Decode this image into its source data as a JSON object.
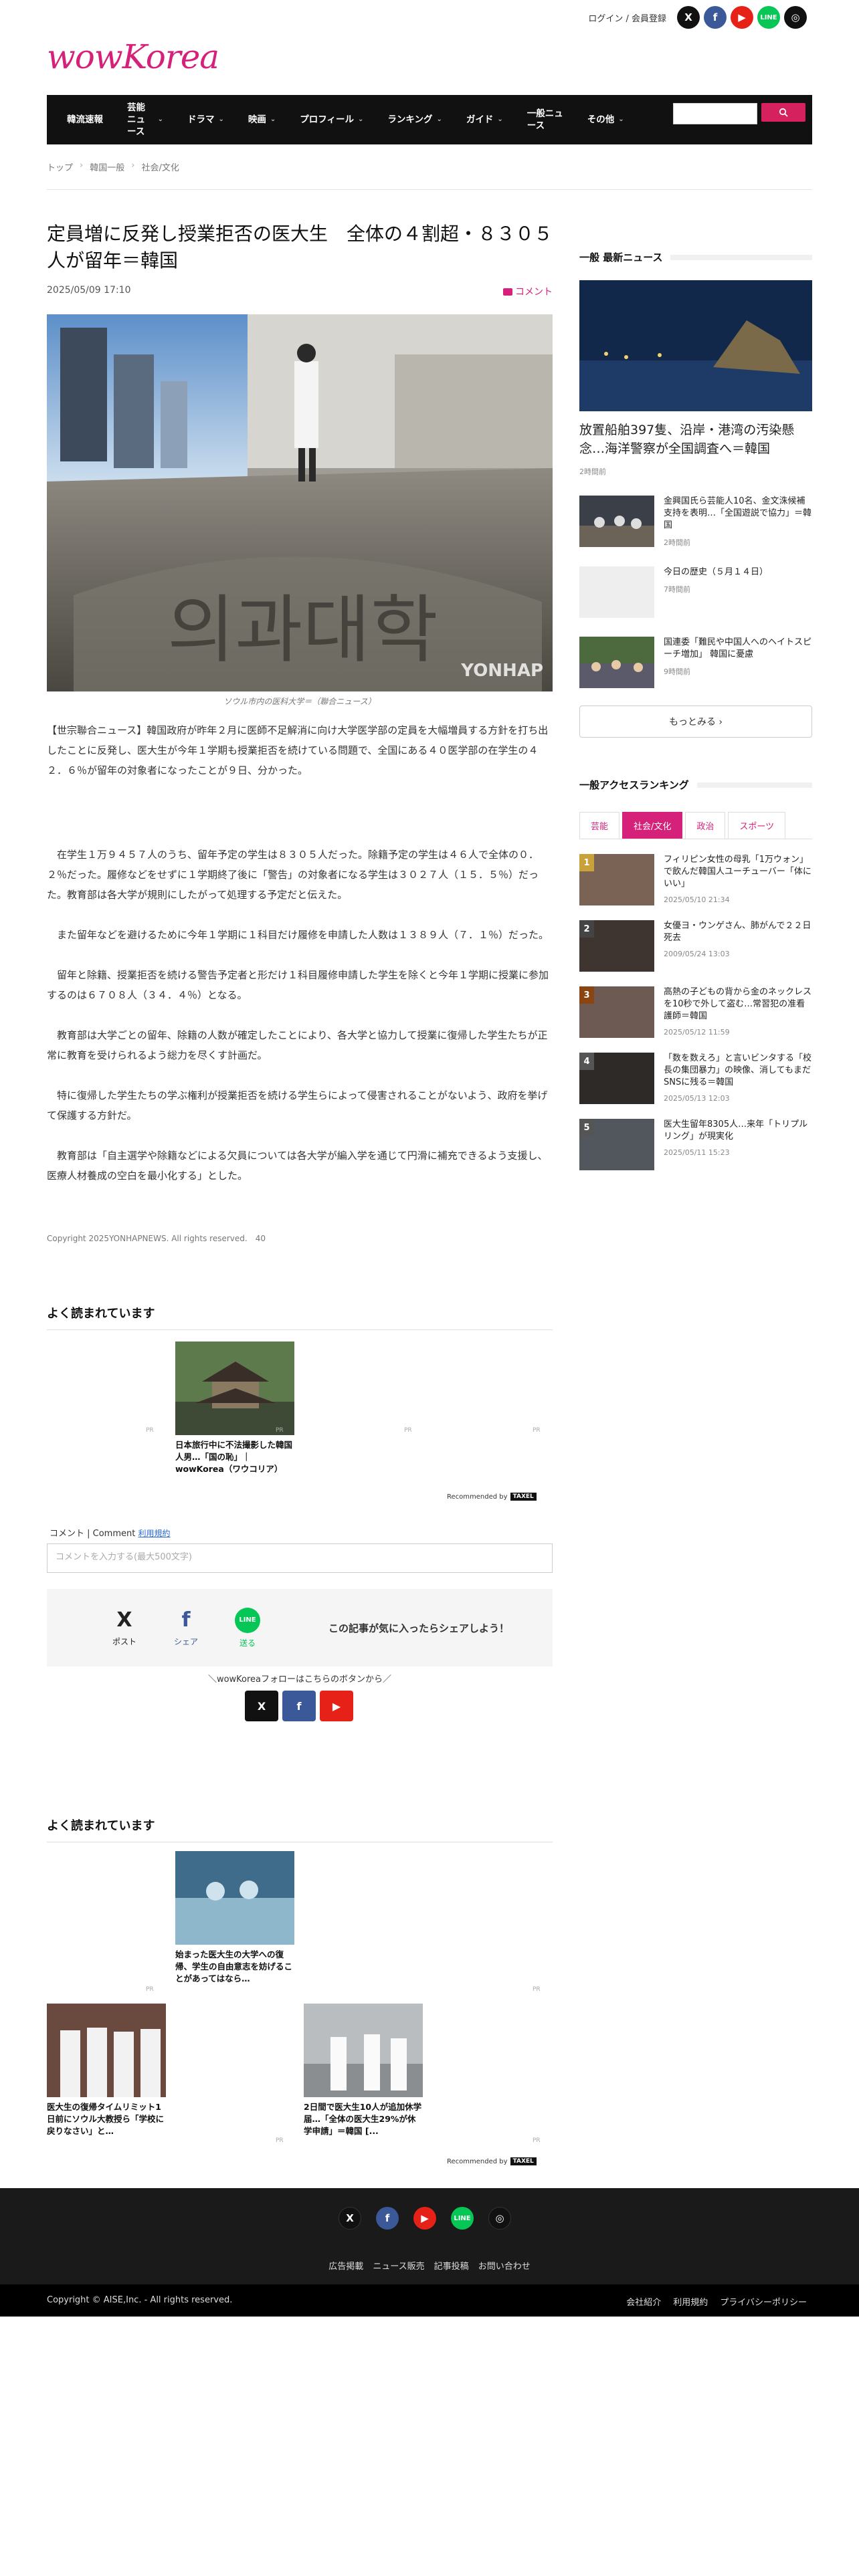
{
  "header": {
    "login": "ログイン / 会員登録",
    "logo": "wowKorea",
    "social": [
      "X",
      "f",
      "▶",
      "LINE",
      "◎"
    ]
  },
  "nav": {
    "items": [
      {
        "label": "韓流速報",
        "dropdown": false
      },
      {
        "label": "芸能ニュース",
        "dropdown": true
      },
      {
        "label": "ドラマ",
        "dropdown": true
      },
      {
        "label": "映画",
        "dropdown": true
      },
      {
        "label": "プロフィール",
        "dropdown": true
      },
      {
        "label": "ランキング",
        "dropdown": true
      },
      {
        "label": "ガイド",
        "dropdown": true
      },
      {
        "label": "一般ニュース",
        "dropdown": false
      },
      {
        "label": "その他",
        "dropdown": true
      }
    ],
    "search_icon": "search-icon"
  },
  "breadcrumb": [
    "トップ",
    "韓国一般",
    "社会/文化"
  ],
  "article": {
    "title": "定員増に反発し授業拒否の医大生　全体の４割超・８３０５人が留年＝韓国",
    "date": "2025/05/09 17:10",
    "comment_link": "コメント",
    "photo_watermark": "YONHAP",
    "caption": "ソウル市内の医科大学＝（聯合ニュース）",
    "paragraphs": [
      "【世宗聯合ニュース】韓国政府が昨年２月に医師不足解消に向け大学医学部の定員を大幅増員する方針を打ち出したことに反発し、医大生が今年１学期も授業拒否を続けている問題で、全国にある４０医学部の在学生の４２．６％が留年の対象者になったことが９日、分かった。",
      "　在学生１万９４５７人のうち、留年予定の学生は８３０５人だった。除籍予定の学生は４６人で全体の０．２％だった。履修などをせずに１学期終了後に「警告」の対象者になる学生は３０２７人（１５．５％）だった。教育部は各大学が規則にしたがって処理する予定だと伝えた。",
      "　また留年などを避けるために今年１学期に１科目だけ履修を申請した人数は１３８９人（７．１％）だった。",
      "　留年と除籍、授業拒否を続ける警告予定者と形だけ１科目履修申請した学生を除くと今年１学期に授業に参加するのは６７０８人（３４．４％）となる。",
      "　教育部は大学ごとの留年、除籍の人数が確定したことにより、各大学と協力して授業に復帰した学生たちが正常に教育を受けられるよう総力を尽くす計画だ。",
      "　特に復帰した学生たちの学ぶ権利が授業拒否を続ける学生らによって侵害されることがないよう、政府を挙げて保護する方針だ。",
      "　教育部は「自主選学や除籍などによる欠員については各大学が編入学を通じて円滑に補充できるよう支援し、医療人材養成の空白を最小化する」とした。"
    ],
    "copyright": "Copyright 2025YONHAPNEWS. All rights reserved.　40"
  },
  "sidebar": {
    "latest_title": "一般 最新ニュース",
    "top_story": {
      "title": "放置船舶397隻、沿岸・港湾の汚染懸念…海洋警察が全国調査へ＝韓国",
      "time": "2時間前"
    },
    "stories": [
      {
        "title": "金興国氏ら芸能人10名、金文洙候補支持を表明…「全国遊説で協力」＝韓国",
        "time": "2時間前"
      },
      {
        "title": "今日の歴史（５月１４日）",
        "time": "7時間前"
      },
      {
        "title": "国連委「難民や中国人へのヘイトスピーチ増加」 韓国に憂慮",
        "time": "9時間前"
      }
    ],
    "more_button": "もっとみる ›",
    "ranking_title": "一般アクセスランキング",
    "tabs": [
      "芸能",
      "社会/文化",
      "政治",
      "スポーツ"
    ],
    "active_tab": "社会/文化",
    "ranking": [
      {
        "rank": "1",
        "title": "フィリピン女性の母乳「1万ウォン」で飲んだ韓国人ユーチューバー「体にいい」",
        "date": "2025/05/10 21:34",
        "color": "#c8a13a"
      },
      {
        "rank": "2",
        "title": "女優ヨ・ウンゲさん、肺がんで２２日死去",
        "date": "2009/05/24 13:03",
        "color": "#444444"
      },
      {
        "rank": "3",
        "title": "高熱の子どもの背から金のネックレスを10秒で外して盗む…常習犯の准看護師＝韓国",
        "date": "2025/05/12 11:59",
        "color": "#8b4513"
      },
      {
        "rank": "4",
        "title": "「数を数えろ」と言いビンタする「校長の集団暴力」の映像、消してもまだSNSに残る＝韓国",
        "date": "2025/05/13 12:03",
        "color": "#555555"
      },
      {
        "rank": "5",
        "title": "医大生留年8305人…来年「トリプルリング」が現実化",
        "date": "2025/05/11 15:23",
        "color": "#555555"
      }
    ]
  },
  "popular1": {
    "heading": "よく読まれています",
    "card": {
      "title": "日本旅行中に不法撮影した韓国人男…「国の恥」｜wowKorea（ワウコリア）",
      "pr": "PR"
    },
    "pr_labels": [
      "PR",
      "PR",
      "PR",
      "PR"
    ],
    "recommended": "Recommended by",
    "taxel": "TAXEL"
  },
  "comment": {
    "label": "コメント | Comment",
    "terms": "利用規約",
    "placeholder": "コメントを入力する(最大500文字)"
  },
  "share": {
    "buttons": [
      {
        "icon": "x-icon",
        "glyph": "X",
        "label": "ポスト",
        "color": "#000000"
      },
      {
        "icon": "facebook-icon",
        "glyph": "f",
        "label": "シェア",
        "color": "#3b5998"
      },
      {
        "icon": "line-icon",
        "glyph": "LINE",
        "label": "送る",
        "color": "#06c755"
      }
    ],
    "message": "この記事が気に入ったらシェアしよう！",
    "follow_label": "＼wowKoreaフォローはこちらのボタンから／",
    "follow": [
      "X",
      "f",
      "▶"
    ]
  },
  "popular2": {
    "heading": "よく読まれています",
    "cards": [
      {
        "title": "始まった医大生の大学への復帰、学生の自由意志を妨げることがあってはなら…"
      },
      {
        "title": "医大生の復帰タイムリミット1日前にソウル大教授ら「学校に戻りなさい」と…"
      },
      {
        "title": "2日間で医大生10人が追加休学届…「全体の医大生29%が休学申請」＝韓国 [..."
      }
    ],
    "pr_labels": [
      "PR",
      "PR",
      "PR",
      "PR"
    ],
    "recommended": "Recommended by",
    "taxel": "TAXEL"
  },
  "footer": {
    "icons": [
      "X",
      "f",
      "▶",
      "LINE",
      "◎"
    ],
    "links": [
      "広告掲載",
      "ニュース販売",
      "記事投稿",
      "お問い合わせ"
    ],
    "copyright": "Copyright © AISE,Inc. - All rights reserved.",
    "bottom_links": [
      "会社紹介",
      "利用規約",
      "プライバシーポリシー"
    ]
  }
}
